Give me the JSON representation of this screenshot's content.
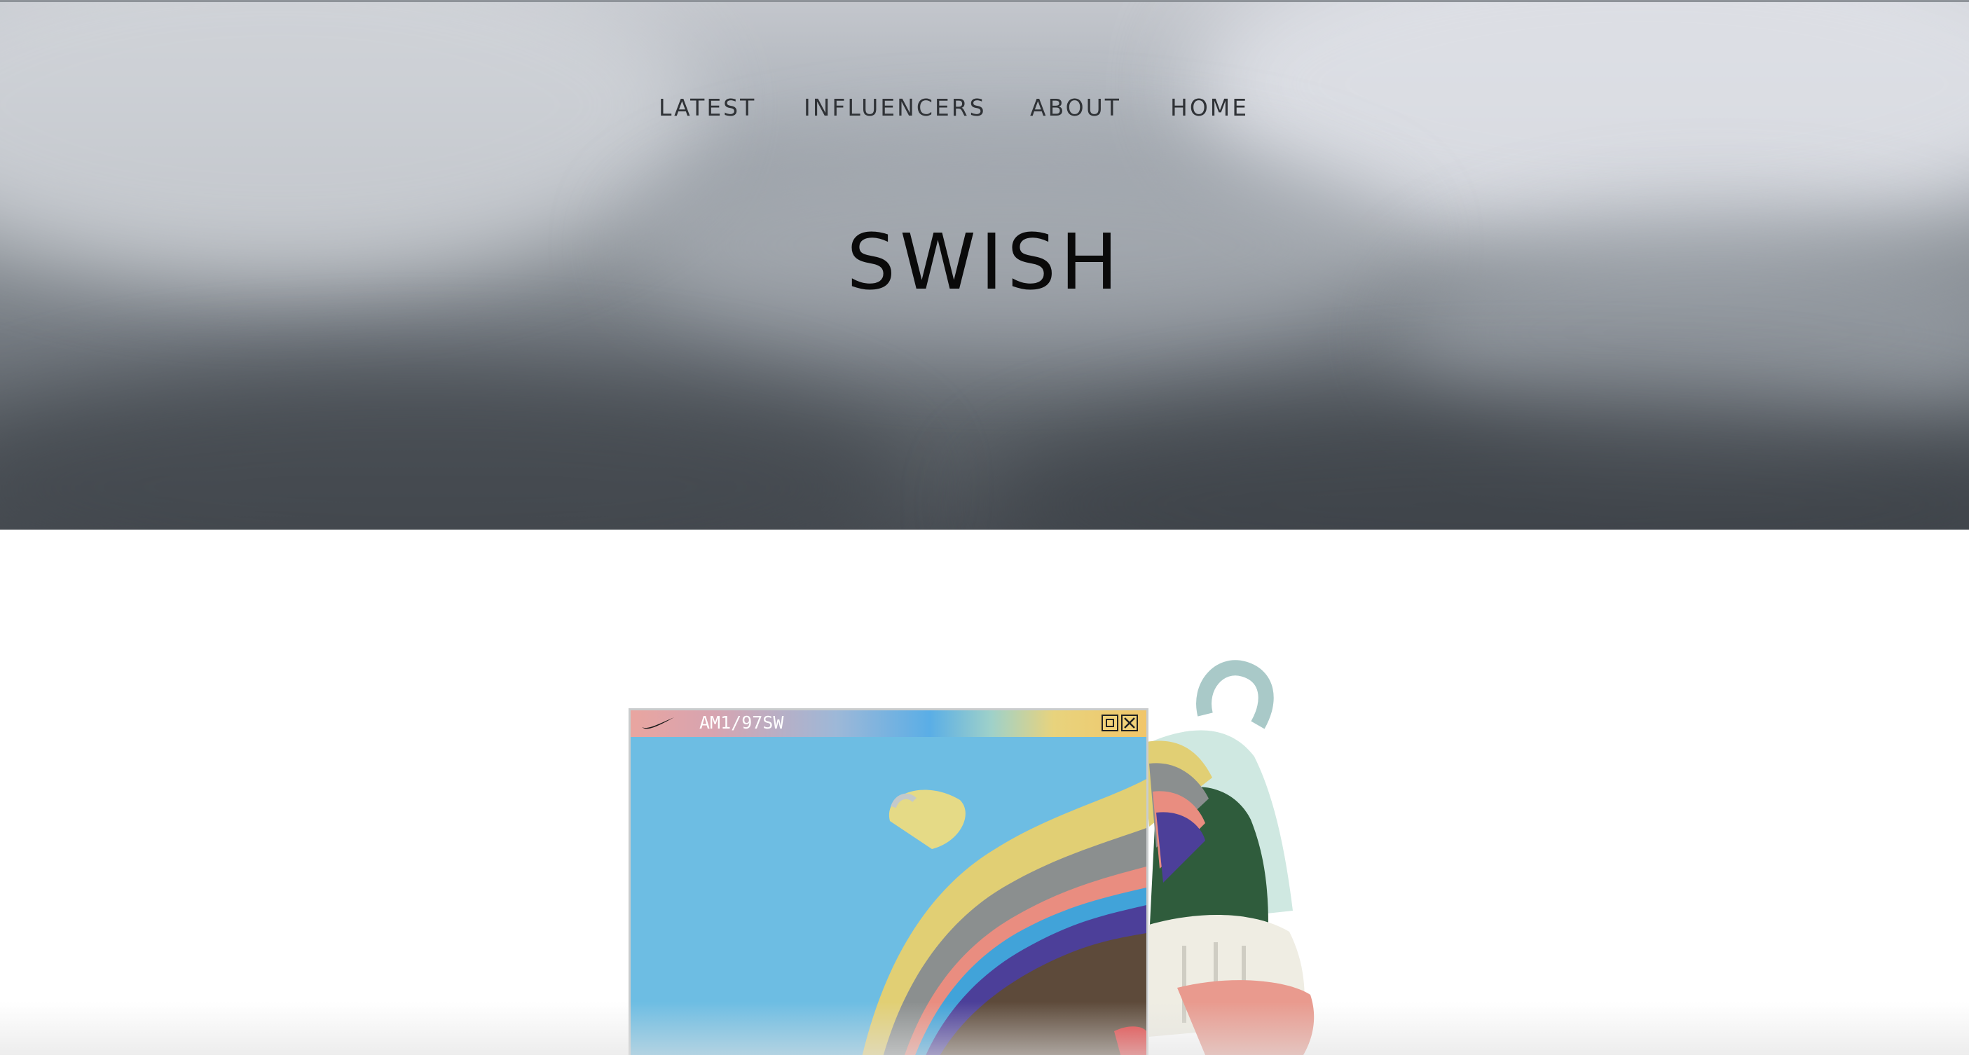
{
  "nav": {
    "items": [
      {
        "label": "LATEST"
      },
      {
        "label": "INFLUENCERS"
      },
      {
        "label": "ABOUT"
      },
      {
        "label": "HOME"
      }
    ]
  },
  "hero": {
    "brand": "SWISH"
  },
  "product_window": {
    "title": "AM1/97SW",
    "icons": [
      "swoosh-icon",
      "maximize-icon",
      "close-icon"
    ]
  },
  "colors": {
    "hero_fog": "#8b9197",
    "sky_blue": "#6dbde3",
    "corduroy_yellow": "#e3d27a",
    "sole_pink": "#e99a8e"
  }
}
